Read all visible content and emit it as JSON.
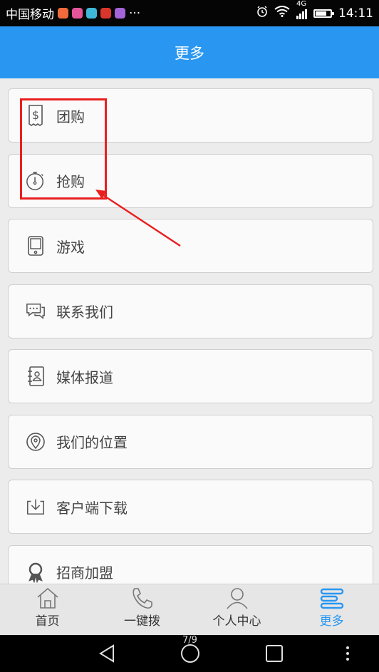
{
  "status_bar": {
    "carrier": "中国移动",
    "more": "···",
    "network": "4G",
    "time": "14:11",
    "battery_level": 0.75,
    "app_icon_colors": [
      "#f06a3b",
      "#e5559b",
      "#3fb8d8",
      "#d9362b",
      "#a363d9"
    ]
  },
  "header": {
    "title": "更多"
  },
  "menu": {
    "items": [
      {
        "label": "团购",
        "icon": "receipt-dollar-icon"
      },
      {
        "label": "抢购",
        "icon": "stopwatch-icon"
      },
      {
        "label": "游戏",
        "icon": "handheld-device-icon"
      },
      {
        "label": "联系我们",
        "icon": "chat-bubbles-icon"
      },
      {
        "label": "媒体报道",
        "icon": "address-book-icon"
      },
      {
        "label": "我们的位置",
        "icon": "location-pin-icon"
      },
      {
        "label": "客户端下载",
        "icon": "download-icon"
      },
      {
        "label": "招商加盟",
        "icon": "award-ribbon-icon"
      }
    ]
  },
  "tabs": {
    "items": [
      {
        "label": "首页",
        "icon": "home-icon"
      },
      {
        "label": "一键拨",
        "icon": "phone-icon"
      },
      {
        "label": "个人中心",
        "icon": "user-icon"
      },
      {
        "label": "更多",
        "icon": "more-menu-icon"
      }
    ],
    "active_index": 3
  },
  "nav": {
    "page_indicator": "7/9"
  },
  "colors": {
    "primary": "#2997f1",
    "annotation": "#e8201f",
    "icon_gray": "#555555"
  }
}
